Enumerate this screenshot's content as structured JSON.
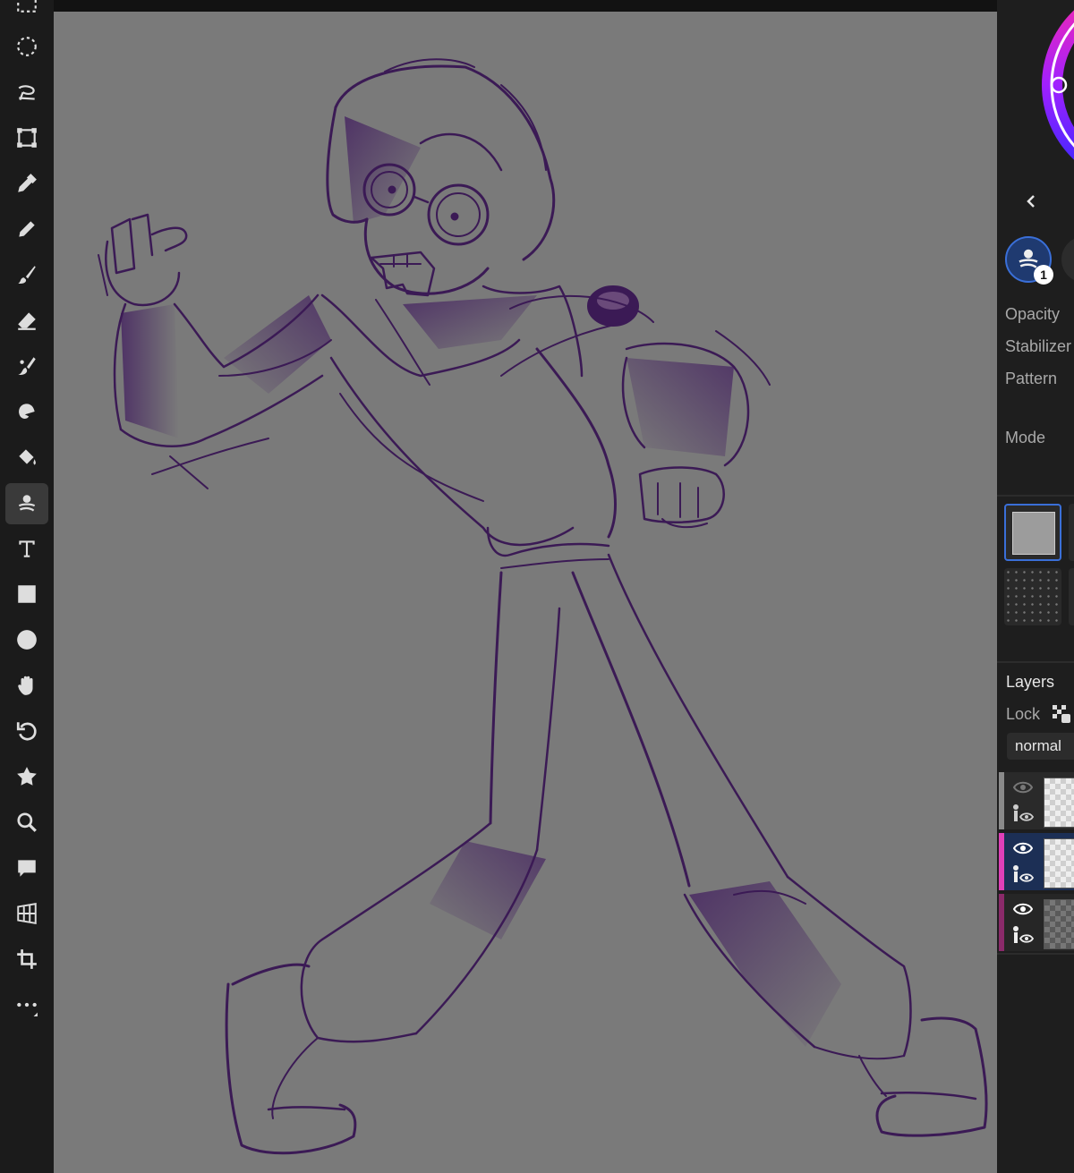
{
  "toolbar": {
    "tools": [
      "marquee-select",
      "ellipse-select",
      "lasso-select",
      "transform",
      "eyedropper",
      "pencil",
      "brush",
      "eraser",
      "smudge",
      "blur",
      "fill",
      "magic-brush",
      "text",
      "rectangle",
      "ellipse",
      "hand",
      "rotate",
      "puzzle",
      "zoom",
      "comment",
      "perspective-grid",
      "crop",
      "more"
    ],
    "active_tool": "magic-brush"
  },
  "colors": {
    "accent": "#3a6fd8",
    "ink": "#3b1a55",
    "canvas_bg": "#7a7a7a",
    "layer_stripe_1": "#8a8a8a",
    "layer_stripe_2": "#e040b8",
    "layer_stripe_3": "#8a2a6a"
  },
  "panel": {
    "collapse_icon": "chevron-left-icon",
    "tool_badge": "1",
    "opacity_label": "Opacity",
    "stabilizer_label": "Stabilizer",
    "pattern_label": "Pattern",
    "mode_label": "Mode",
    "layers_title": "Layers",
    "lock_label": "Lock",
    "blend_mode": "normal"
  },
  "layers": [
    {
      "visible": false,
      "selected": false,
      "thumb": "transparent"
    },
    {
      "visible": true,
      "selected": true,
      "thumb": "transparent"
    },
    {
      "visible": true,
      "selected": false,
      "thumb": "dark"
    }
  ]
}
